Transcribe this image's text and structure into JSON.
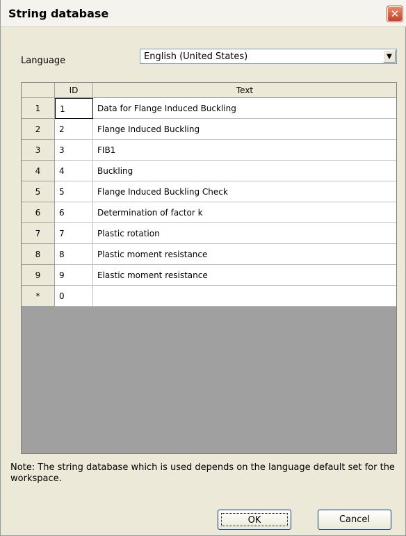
{
  "window": {
    "title": "String database",
    "close_glyph": "✕"
  },
  "language": {
    "label": "Language",
    "selected": "English (United States)",
    "arrow_glyph": "▼"
  },
  "grid": {
    "columns": [
      "ID",
      "Text"
    ],
    "rows": [
      {
        "row_header": "1",
        "id": "1",
        "text": "Data for Flange Induced Buckling"
      },
      {
        "row_header": "2",
        "id": "2",
        "text": "Flange Induced Buckling"
      },
      {
        "row_header": "3",
        "id": "3",
        "text": "FIB1"
      },
      {
        "row_header": "4",
        "id": "4",
        "text": "Buckling"
      },
      {
        "row_header": "5",
        "id": "5",
        "text": "Flange Induced Buckling Check"
      },
      {
        "row_header": "6",
        "id": "6",
        "text": "Determination of factor k"
      },
      {
        "row_header": "7",
        "id": "7",
        "text": "Plastic rotation"
      },
      {
        "row_header": "8",
        "id": "8",
        "text": "Plastic moment resistance"
      },
      {
        "row_header": "9",
        "id": "9",
        "text": "Elastic moment resistance"
      },
      {
        "row_header": "*",
        "id": "0",
        "text": ""
      }
    ]
  },
  "note": "Note: The string database which is used depends on the language default set for the workspace.",
  "buttons": {
    "ok": "OK",
    "cancel": "Cancel"
  }
}
